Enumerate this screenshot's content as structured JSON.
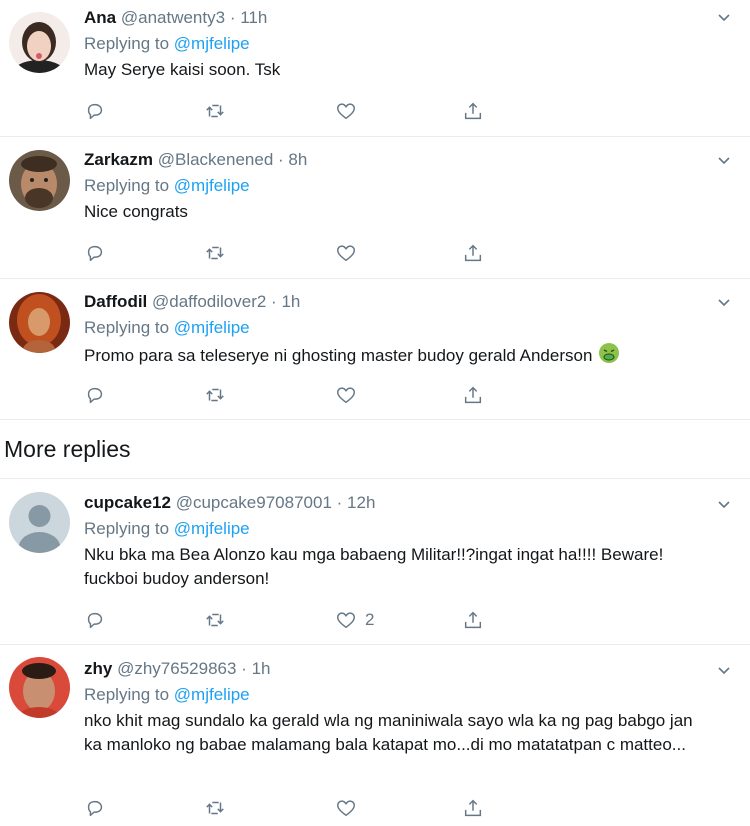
{
  "replying_prefix": "Replying to",
  "tweets": [
    {
      "name": "Ana",
      "handle": "@anatwenty3",
      "separator": "·",
      "time": "11h",
      "replying_to": "@mjfelipe",
      "text": "May Serye kaisi soon. Tsk",
      "likes": ""
    },
    {
      "name": "Zarkazm",
      "handle": "@Blackenened",
      "separator": "·",
      "time": "8h",
      "replying_to": "@mjfelipe",
      "text": "Nice congrats",
      "likes": ""
    },
    {
      "name": "Daffodil",
      "handle": "@daffodilover2",
      "separator": "·",
      "time": "1h",
      "replying_to": "@mjfelipe",
      "text": "Promo para sa teleserye ni ghosting master budoy gerald Anderson",
      "emoji": "face-vomiting-emoji",
      "likes": ""
    }
  ],
  "more_replies_label": "More replies",
  "more_tweets": [
    {
      "name": "cupcake12",
      "handle": "@cupcake97087001",
      "separator": "·",
      "time": "12h",
      "replying_to": "@mjfelipe",
      "text": "Nku bka ma Bea Alonzo kau mga babaeng Militar!!?ingat ingat ha!!!! Beware! fuckboi budoy anderson!",
      "likes": "2"
    },
    {
      "name": "zhy",
      "handle": "@zhy76529863",
      "separator": "·",
      "time": "1h",
      "replying_to": "@mjfelipe",
      "text": "nko khit mag sundalo ka gerald wla ng maniniwala sayo wla ka ng pag babgo jan ka manloko ng babae malamang bala katapat mo...di mo matatatpan c matteo...",
      "likes": ""
    }
  ],
  "colors": {
    "accent": "#1da1f2",
    "secondary_text": "#657786",
    "divider": "#e6ecf0"
  }
}
